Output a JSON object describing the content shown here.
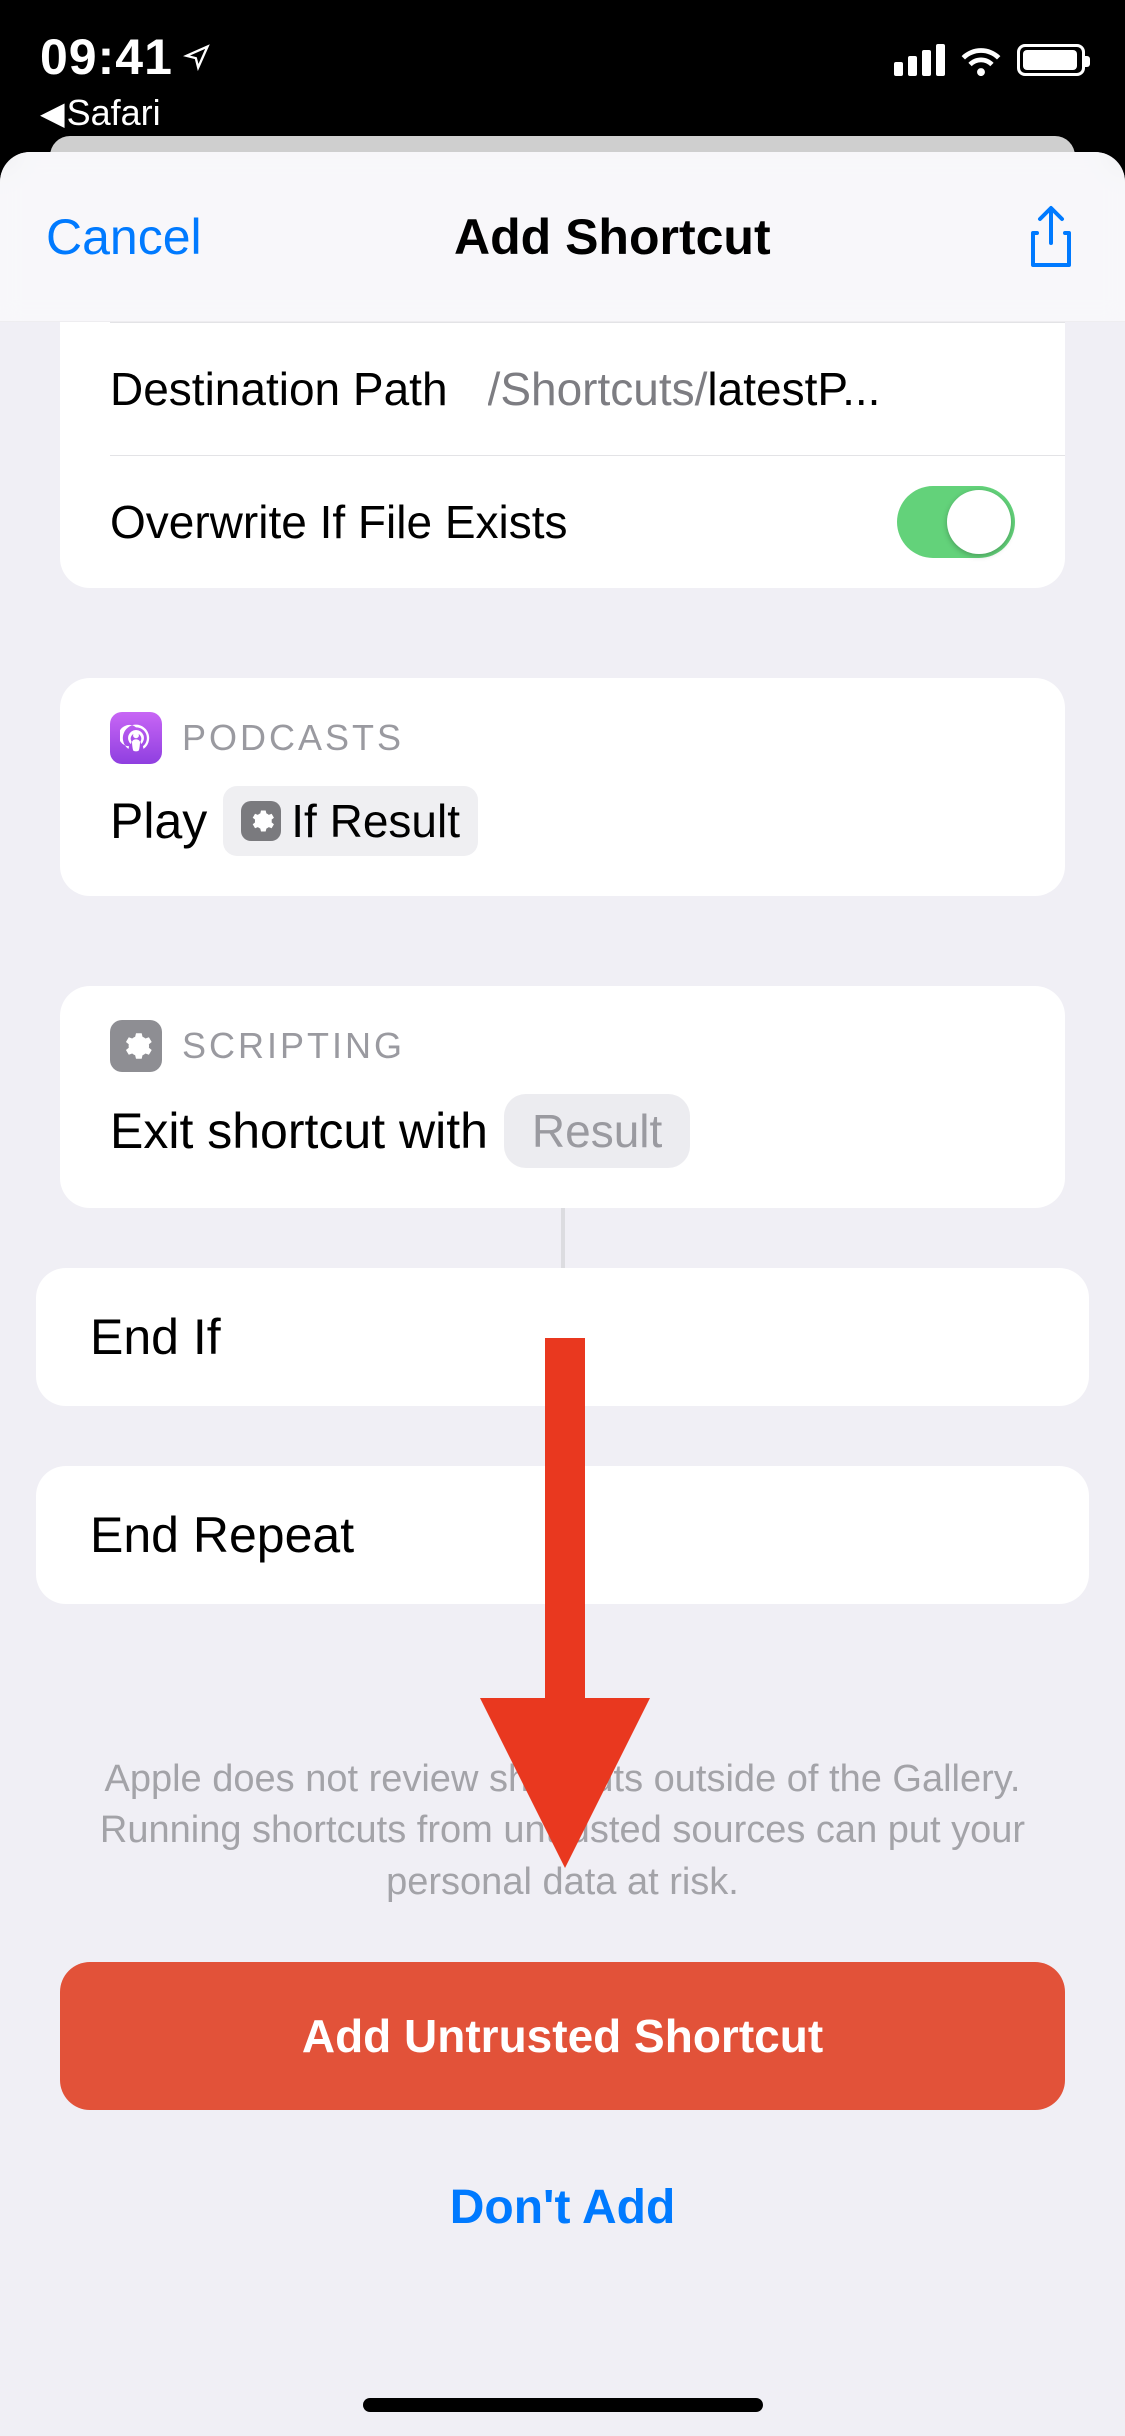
{
  "status": {
    "time": "09:41",
    "back_app": "Safari"
  },
  "nav": {
    "cancel": "Cancel",
    "title": "Add Shortcut"
  },
  "action_file": {
    "dest_label": "Destination Path",
    "dest_value_grey": "/Shortcuts/",
    "dest_value_dark": "latestP...",
    "overwrite_label": "Overwrite If File Exists"
  },
  "action_podcast": {
    "header": "PODCASTS",
    "body_prefix": "Play",
    "var_label": "If Result"
  },
  "action_script": {
    "header": "SCRIPTING",
    "body_prefix": "Exit shortcut with",
    "param_label": "Result"
  },
  "flow": {
    "end_if": "End If",
    "end_repeat": "End Repeat"
  },
  "footer": {
    "warning": "Apple does not review shortcuts outside of the Gallery. Running shortcuts from untrusted sources can put your personal data at risk.",
    "add_btn": "Add Untrusted Shortcut",
    "dont_btn": "Don't Add"
  }
}
